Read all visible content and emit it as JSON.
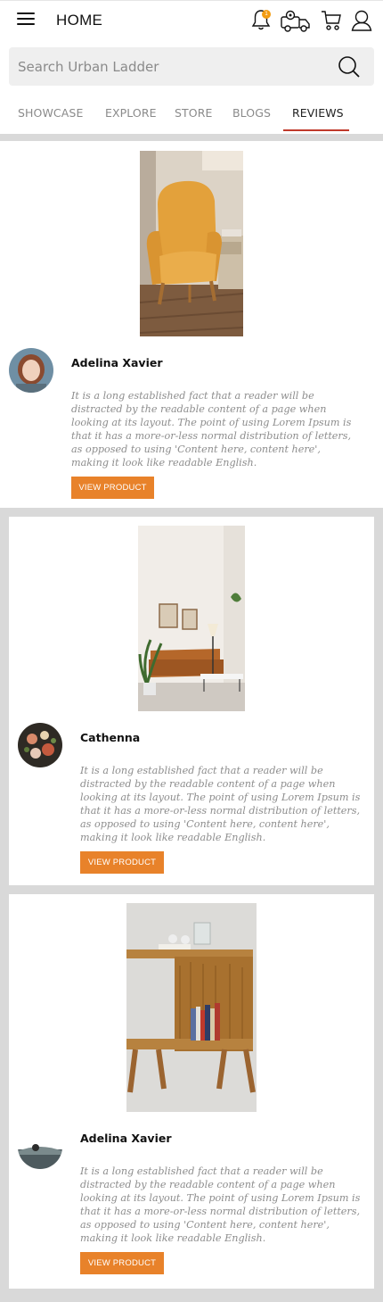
{
  "header": {
    "title": "HOME",
    "notification_count": "1",
    "icons": [
      "menu-icon",
      "bell-icon",
      "delivery-truck-icon",
      "cart-icon",
      "user-icon"
    ]
  },
  "search": {
    "placeholder": "Search Urban Ladder"
  },
  "tabs": [
    {
      "label": "SHOWCASE",
      "active": false
    },
    {
      "label": "EXPLORE",
      "active": false
    },
    {
      "label": "STORE",
      "active": false
    },
    {
      "label": "BLOGS",
      "active": false
    },
    {
      "label": "REVIEWS",
      "active": true
    }
  ],
  "reviews": [
    {
      "name": "Adelina Xavier",
      "text": "It is a long established fact that a reader will be distracted by the readable content of a page when looking at its layout. The point of using Lorem Ipsum is that it has a more-or-less normal distribution of letters, as opposed to using 'Content here, content here', making it look like readable English.",
      "button": "VIEW PRODUCT",
      "image": "mustard-armchair-photo"
    },
    {
      "name": "Cathenna",
      "text": "It is a long established fact that a reader will be distracted by the readable content of a page when looking at its layout. The point of using Lorem Ipsum is that it has a more-or-less normal distribution of letters, as opposed to using 'Content here, content here', making it look like readable English.",
      "button": "VIEW PRODUCT",
      "image": "living-room-sofa-photo"
    },
    {
      "name": "Adelina Xavier",
      "text": "It is a long established fact that a reader will be distracted by the readable content of a page when looking at its layout. The point of using Lorem Ipsum is that it has a more-or-less normal distribution of letters, as opposed to using 'Content here, content here', making it look like readable English.",
      "button": "VIEW PRODUCT",
      "image": "wooden-side-table-photo"
    }
  ],
  "colors": {
    "accent_button": "#e8822a",
    "tab_underline": "#c0392b",
    "badge": "#f39c12",
    "background": "#d9d9d9"
  }
}
